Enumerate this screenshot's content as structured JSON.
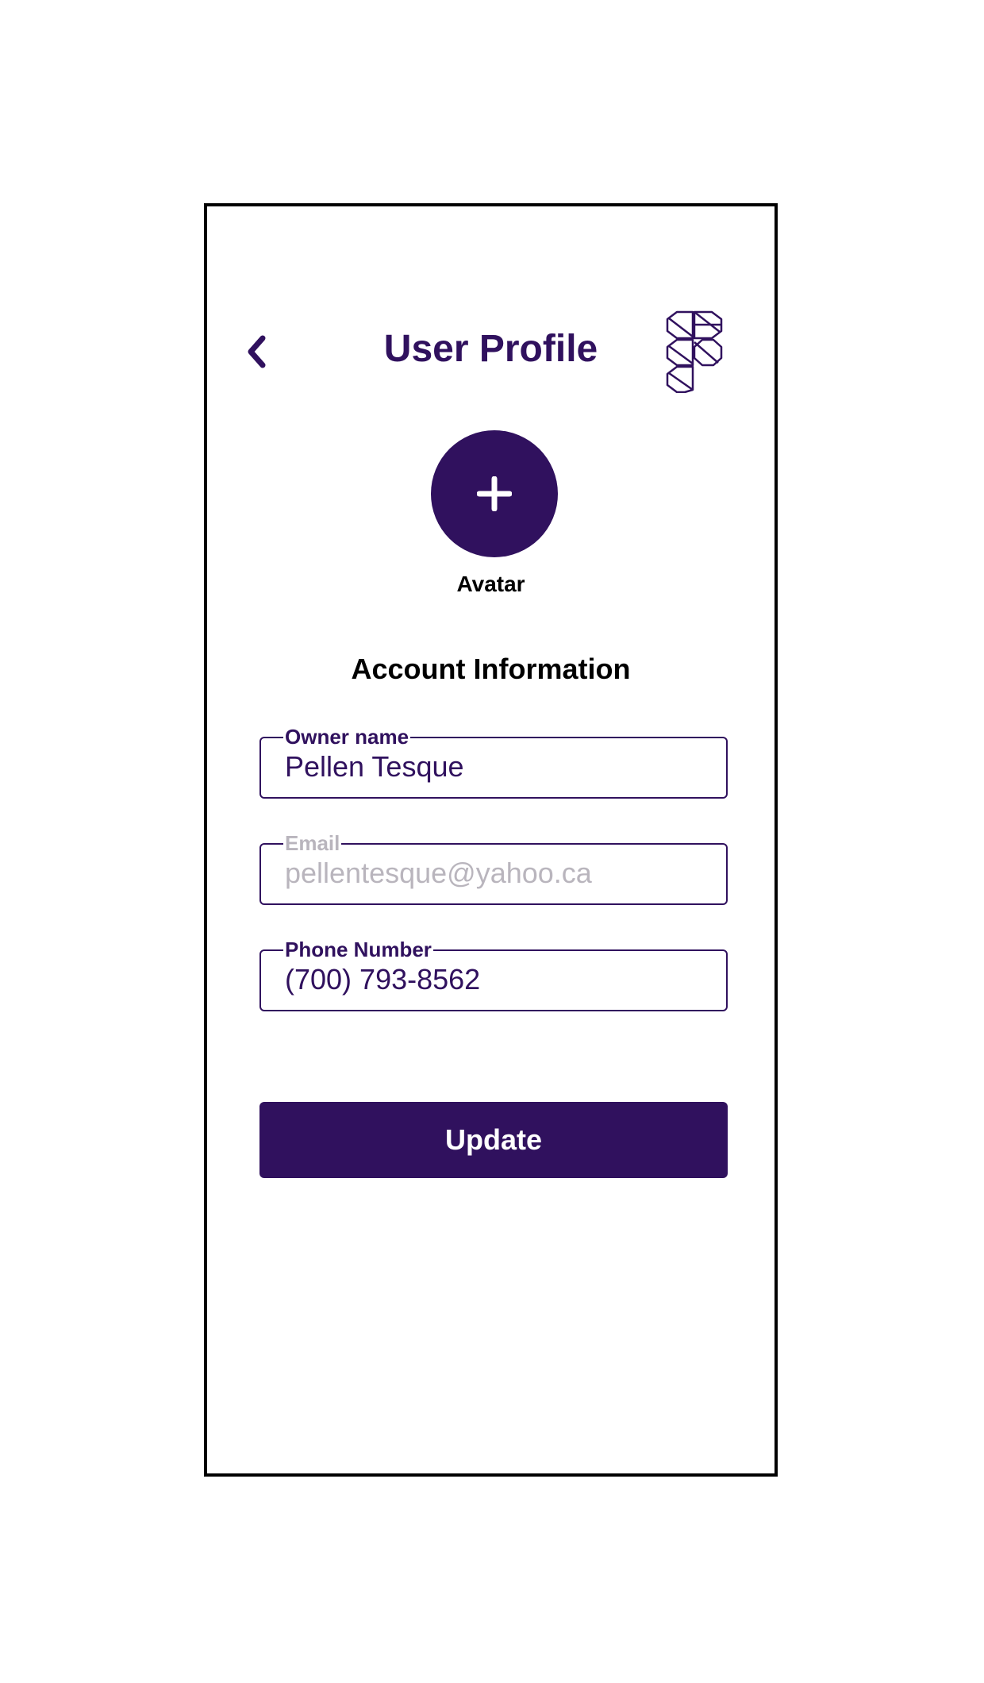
{
  "colors": {
    "primary": "#30115e",
    "muted": "#b9b5bd",
    "frame": "#000000",
    "background": "#ffffff"
  },
  "header": {
    "back_icon": "chevron-left-icon",
    "title": "User Profile",
    "logo_icon": "figma-logo-icon"
  },
  "avatar": {
    "icon": "plus-icon",
    "label": "Avatar"
  },
  "account": {
    "section_title": "Account Information",
    "fields": [
      {
        "label": "Owner name",
        "value": "Pellen Tesque",
        "state": "active"
      },
      {
        "label": "Email",
        "value": "pellentesque@yahoo.ca",
        "state": "disabled"
      },
      {
        "label": "Phone Number",
        "value": "(700) 793-8562",
        "state": "active"
      }
    ]
  },
  "actions": {
    "update_label": "Update"
  }
}
